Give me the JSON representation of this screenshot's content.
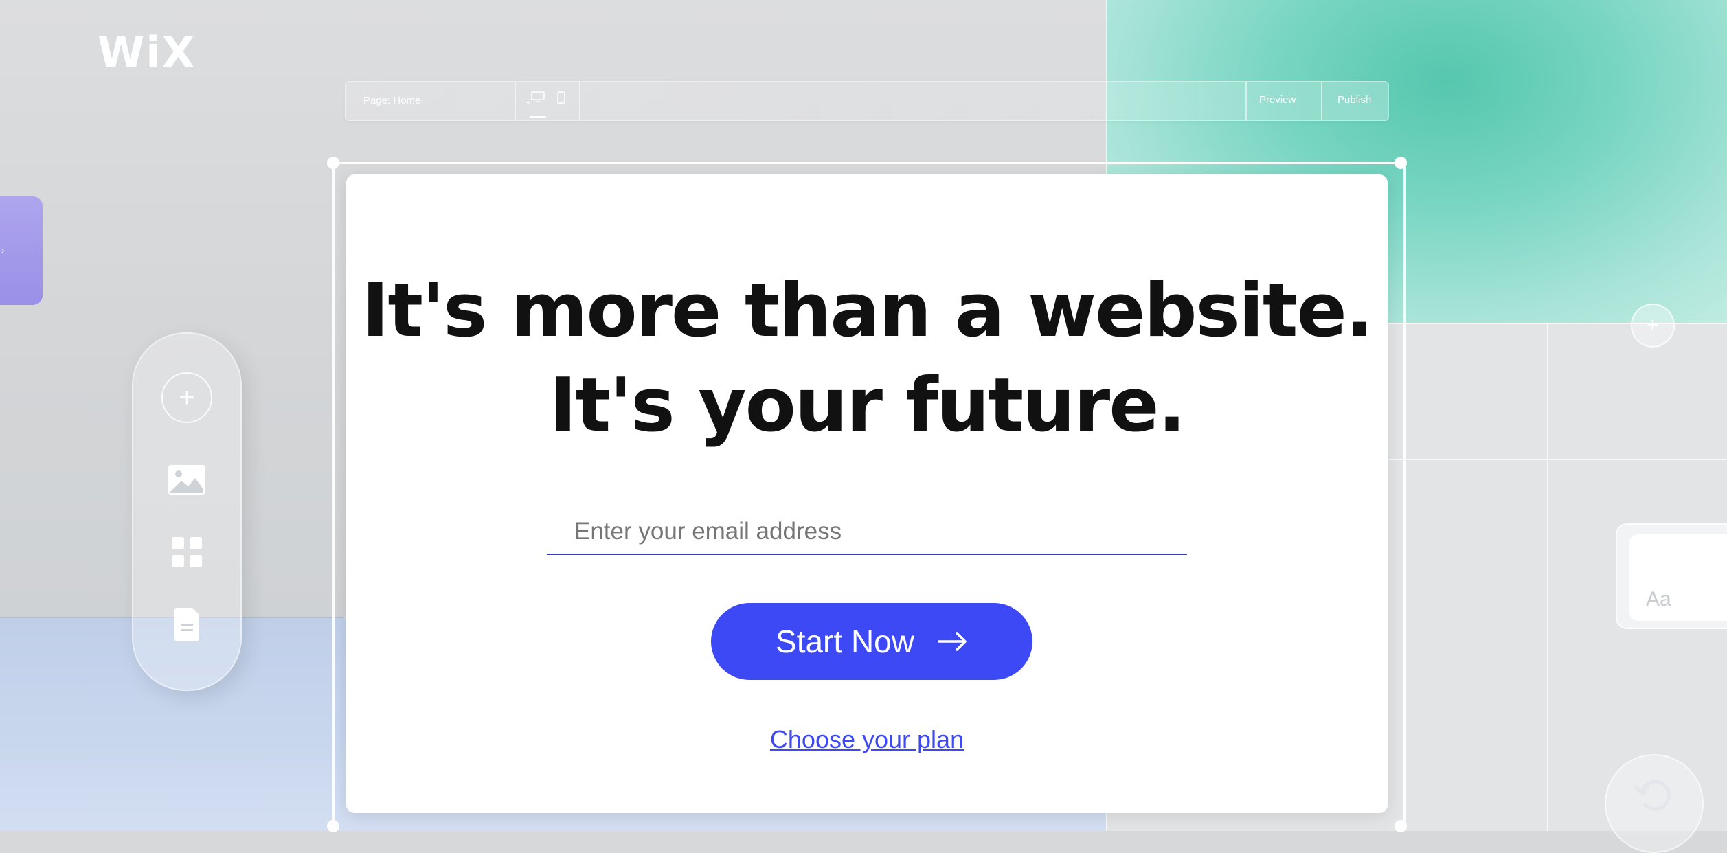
{
  "brand": {
    "logo": "WiX"
  },
  "editor_toolbar": {
    "page_select": "Page: Home",
    "preview": "Preview",
    "publish": "Publish"
  },
  "hero": {
    "headline_line1": "It's more than a website.",
    "headline_line2": "It's your future.",
    "email_placeholder": "Enter your email address",
    "cta_label": "Start Now",
    "plan_link": "Choose your plan"
  },
  "decor": {
    "text_card_label": "Aa"
  },
  "colors": {
    "accent": "#3d49f5",
    "teal": "#56c7ae",
    "lavender": "#a79df2"
  },
  "icons": [
    "add-icon",
    "image-icon",
    "apps-grid-icon",
    "page-icon",
    "desktop-icon",
    "mobile-icon",
    "chevron-down-icon",
    "arrow-right-icon",
    "undo-icon"
  ]
}
